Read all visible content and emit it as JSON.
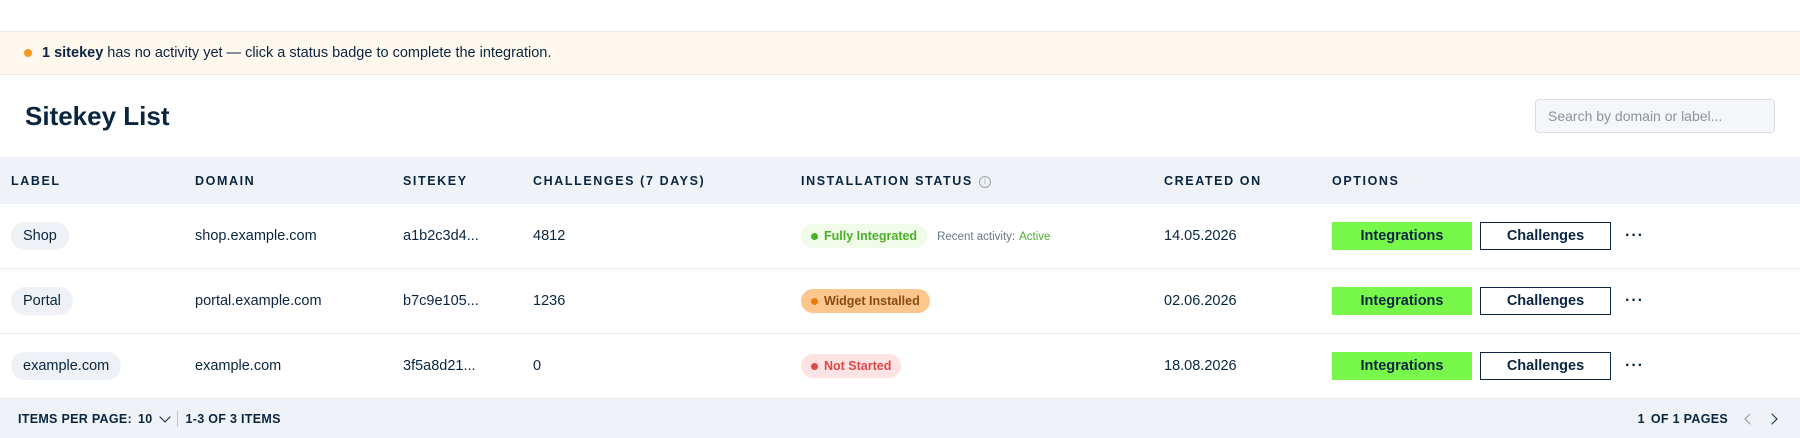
{
  "banner": {
    "count_text": "1 sitekey",
    "message": "has no activity yet — click a status badge to complete the integration."
  },
  "header": {
    "title": "Sitekey List",
    "search_placeholder": "Search by domain or label..."
  },
  "table": {
    "columns": [
      "LABEL",
      "DOMAIN",
      "SITEKEY",
      "CHALLENGES (7 DAYS)",
      "INSTALLATION STATUS",
      "CREATED ON",
      "OPTIONS"
    ],
    "rows": [
      {
        "label": "Shop",
        "domain": "shop.example.com",
        "sitekey": "a1b2c3d4...",
        "challenges": "4812",
        "status": "Fully Integrated",
        "recent_label": "Recent activity:",
        "recent_value": "Active",
        "created": "14.05.2026"
      },
      {
        "label": "Portal",
        "domain": "portal.example.com",
        "sitekey": "b7c9e105...",
        "challenges": "1236",
        "status": "Widget Installed",
        "created": "02.06.2026"
      },
      {
        "label": "example.com",
        "domain": "example.com",
        "sitekey": "3f5a8d21...",
        "challenges": "0",
        "status": "Not Started",
        "created": "18.08.2026"
      }
    ],
    "actions": {
      "integrations_label": "Integrations",
      "challenges_label": "Challenges",
      "more_label": "···"
    }
  },
  "footer": {
    "items_per_page_label": "ITEMS PER PAGE:",
    "items_per_page_value": "10",
    "range_text": "1-3 OF 3 ITEMS",
    "page_current": "1",
    "page_total_text": "OF 1 PAGES"
  },
  "colors": {
    "accent_green": "#79f84c",
    "navy": "#0a2540",
    "status_green": "#4caf2a",
    "status_orange": "#fbc78d",
    "status_red": "#e04848",
    "banner_bg": "#fff8ee"
  },
  "icons": [
    "info-icon",
    "chevron-down-icon",
    "chevron-left-icon",
    "chevron-right-icon",
    "more-icon"
  ]
}
